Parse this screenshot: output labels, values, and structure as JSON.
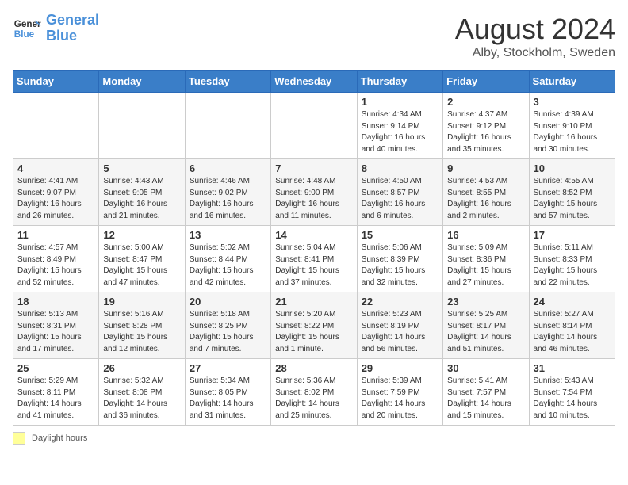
{
  "header": {
    "logo_line1": "General",
    "logo_line2": "Blue",
    "month_year": "August 2024",
    "location": "Alby, Stockholm, Sweden"
  },
  "days_of_week": [
    "Sunday",
    "Monday",
    "Tuesday",
    "Wednesday",
    "Thursday",
    "Friday",
    "Saturday"
  ],
  "legend_label": "Daylight hours",
  "weeks": [
    [
      {
        "day": "",
        "info": ""
      },
      {
        "day": "",
        "info": ""
      },
      {
        "day": "",
        "info": ""
      },
      {
        "day": "",
        "info": ""
      },
      {
        "day": "1",
        "info": "Sunrise: 4:34 AM\nSunset: 9:14 PM\nDaylight: 16 hours\nand 40 minutes."
      },
      {
        "day": "2",
        "info": "Sunrise: 4:37 AM\nSunset: 9:12 PM\nDaylight: 16 hours\nand 35 minutes."
      },
      {
        "day": "3",
        "info": "Sunrise: 4:39 AM\nSunset: 9:10 PM\nDaylight: 16 hours\nand 30 minutes."
      }
    ],
    [
      {
        "day": "4",
        "info": "Sunrise: 4:41 AM\nSunset: 9:07 PM\nDaylight: 16 hours\nand 26 minutes."
      },
      {
        "day": "5",
        "info": "Sunrise: 4:43 AM\nSunset: 9:05 PM\nDaylight: 16 hours\nand 21 minutes."
      },
      {
        "day": "6",
        "info": "Sunrise: 4:46 AM\nSunset: 9:02 PM\nDaylight: 16 hours\nand 16 minutes."
      },
      {
        "day": "7",
        "info": "Sunrise: 4:48 AM\nSunset: 9:00 PM\nDaylight: 16 hours\nand 11 minutes."
      },
      {
        "day": "8",
        "info": "Sunrise: 4:50 AM\nSunset: 8:57 PM\nDaylight: 16 hours\nand 6 minutes."
      },
      {
        "day": "9",
        "info": "Sunrise: 4:53 AM\nSunset: 8:55 PM\nDaylight: 16 hours\nand 2 minutes."
      },
      {
        "day": "10",
        "info": "Sunrise: 4:55 AM\nSunset: 8:52 PM\nDaylight: 15 hours\nand 57 minutes."
      }
    ],
    [
      {
        "day": "11",
        "info": "Sunrise: 4:57 AM\nSunset: 8:49 PM\nDaylight: 15 hours\nand 52 minutes."
      },
      {
        "day": "12",
        "info": "Sunrise: 5:00 AM\nSunset: 8:47 PM\nDaylight: 15 hours\nand 47 minutes."
      },
      {
        "day": "13",
        "info": "Sunrise: 5:02 AM\nSunset: 8:44 PM\nDaylight: 15 hours\nand 42 minutes."
      },
      {
        "day": "14",
        "info": "Sunrise: 5:04 AM\nSunset: 8:41 PM\nDaylight: 15 hours\nand 37 minutes."
      },
      {
        "day": "15",
        "info": "Sunrise: 5:06 AM\nSunset: 8:39 PM\nDaylight: 15 hours\nand 32 minutes."
      },
      {
        "day": "16",
        "info": "Sunrise: 5:09 AM\nSunset: 8:36 PM\nDaylight: 15 hours\nand 27 minutes."
      },
      {
        "day": "17",
        "info": "Sunrise: 5:11 AM\nSunset: 8:33 PM\nDaylight: 15 hours\nand 22 minutes."
      }
    ],
    [
      {
        "day": "18",
        "info": "Sunrise: 5:13 AM\nSunset: 8:31 PM\nDaylight: 15 hours\nand 17 minutes."
      },
      {
        "day": "19",
        "info": "Sunrise: 5:16 AM\nSunset: 8:28 PM\nDaylight: 15 hours\nand 12 minutes."
      },
      {
        "day": "20",
        "info": "Sunrise: 5:18 AM\nSunset: 8:25 PM\nDaylight: 15 hours\nand 7 minutes."
      },
      {
        "day": "21",
        "info": "Sunrise: 5:20 AM\nSunset: 8:22 PM\nDaylight: 15 hours\nand 1 minute."
      },
      {
        "day": "22",
        "info": "Sunrise: 5:23 AM\nSunset: 8:19 PM\nDaylight: 14 hours\nand 56 minutes."
      },
      {
        "day": "23",
        "info": "Sunrise: 5:25 AM\nSunset: 8:17 PM\nDaylight: 14 hours\nand 51 minutes."
      },
      {
        "day": "24",
        "info": "Sunrise: 5:27 AM\nSunset: 8:14 PM\nDaylight: 14 hours\nand 46 minutes."
      }
    ],
    [
      {
        "day": "25",
        "info": "Sunrise: 5:29 AM\nSunset: 8:11 PM\nDaylight: 14 hours\nand 41 minutes."
      },
      {
        "day": "26",
        "info": "Sunrise: 5:32 AM\nSunset: 8:08 PM\nDaylight: 14 hours\nand 36 minutes."
      },
      {
        "day": "27",
        "info": "Sunrise: 5:34 AM\nSunset: 8:05 PM\nDaylight: 14 hours\nand 31 minutes."
      },
      {
        "day": "28",
        "info": "Sunrise: 5:36 AM\nSunset: 8:02 PM\nDaylight: 14 hours\nand 25 minutes."
      },
      {
        "day": "29",
        "info": "Sunrise: 5:39 AM\nSunset: 7:59 PM\nDaylight: 14 hours\nand 20 minutes."
      },
      {
        "day": "30",
        "info": "Sunrise: 5:41 AM\nSunset: 7:57 PM\nDaylight: 14 hours\nand 15 minutes."
      },
      {
        "day": "31",
        "info": "Sunrise: 5:43 AM\nSunset: 7:54 PM\nDaylight: 14 hours\nand 10 minutes."
      }
    ]
  ]
}
